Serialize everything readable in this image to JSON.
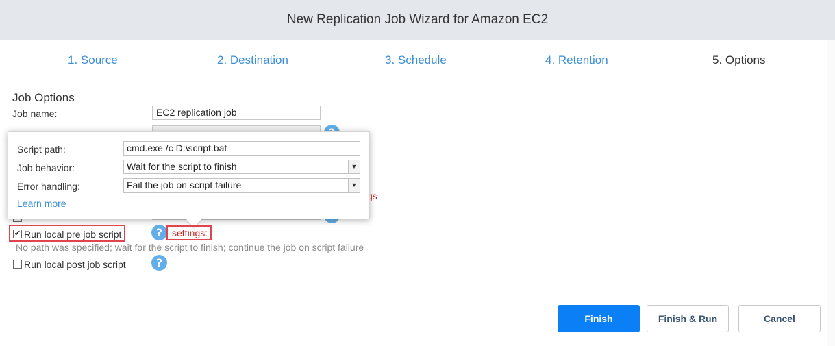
{
  "window": {
    "title": "New Replication Job Wizard for Amazon EC2"
  },
  "steps": [
    {
      "label": "1. Source"
    },
    {
      "label": "2. Destination"
    },
    {
      "label": "3. Schedule"
    },
    {
      "label": "4. Retention"
    },
    {
      "label": "5. Options",
      "active": true
    }
  ],
  "job_options": {
    "section_title": "Job Options",
    "job_name_label": "Job name:",
    "job_name_value": "EC2 replication job",
    "partial_red_text": "gs"
  },
  "script_popup": {
    "script_path_label": "Script path:",
    "script_path_value": "cmd.exe /c D:\\script.bat",
    "job_behavior_label": "Job behavior:",
    "job_behavior_value": "Wait for the script to finish",
    "error_handling_label": "Error handling:",
    "error_handling_value": "Fail the job on script failure",
    "learn_more": "Learn more"
  },
  "pre_script": {
    "label": "Run local pre job script",
    "checked": true,
    "settings_link": "settings:",
    "hint": "No path was specified; wait for the script to finish; continue the job on script failure"
  },
  "post_script": {
    "label": "Run local post job script",
    "checked": false
  },
  "icons": {
    "help": "?",
    "dropdown": "▼",
    "check": "✔"
  },
  "buttons": {
    "finish": "Finish",
    "finish_run": "Finish & Run",
    "cancel": "Cancel"
  },
  "colors": {
    "accent": "#3a8fd8",
    "primary_button": "#0b7ff5",
    "highlight": "#e0454f",
    "error": "#cc1f1f"
  }
}
